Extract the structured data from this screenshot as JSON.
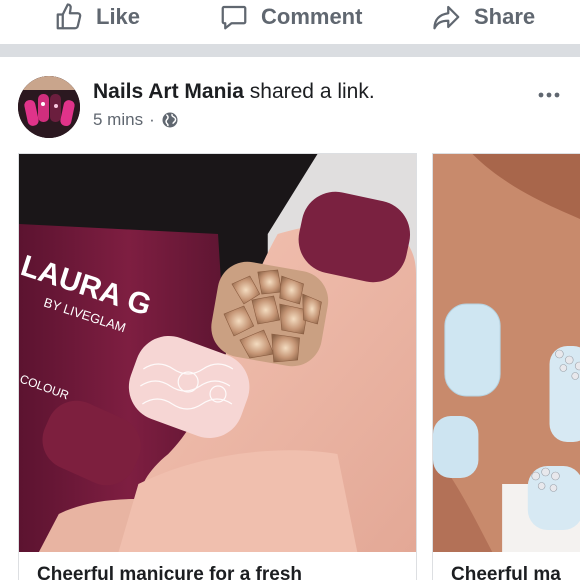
{
  "actions": {
    "like": "Like",
    "comment": "Comment",
    "share": "Share"
  },
  "post": {
    "author": "Nails Art Mania",
    "action_text": " shared a link.",
    "time": "5 mins",
    "separator": "·",
    "privacy_icon": "globe-icon",
    "more_icon": "more-options-icon"
  },
  "bottle": {
    "brand": "LAURA G",
    "sub": "BY LIVEGLAM",
    "colour": "COLOUR"
  },
  "cards": [
    {
      "title": "Cheerful manicure for a fresh"
    },
    {
      "title": "Cheerful ma"
    }
  ],
  "colors": {
    "icon_gray": "#606770",
    "text_dark": "#1c1e21",
    "separator": "#dadde1",
    "burgundy": "#7d1f3e",
    "pale_blue": "#cfe6f2"
  }
}
